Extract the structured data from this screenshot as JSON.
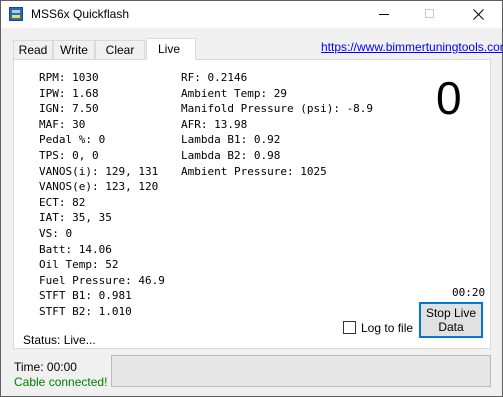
{
  "window": {
    "title": "MSS6x Quickflash",
    "accent_color": "#0078d7",
    "status_ok_color": "#008000",
    "link_color": "#0000ff"
  },
  "tabs": [
    {
      "label": "Read"
    },
    {
      "label": "Write"
    },
    {
      "label": "Clear"
    },
    {
      "label": "Live",
      "selected": true
    }
  ],
  "link": {
    "text": "https://www.bimmertuningtools.com"
  },
  "live": {
    "left_column": [
      "RPM: 1030",
      "IPW: 1.68",
      "IGN: 7.50",
      "MAF: 30",
      "Pedal %: 0",
      "TPS: 0, 0",
      "VANOS(i): 129, 131",
      "VANOS(e): 123, 120",
      "ECT: 82",
      "IAT: 35, 35",
      "VS: 0",
      "Batt: 14.06",
      "Oil Temp: 52",
      "Fuel Pressure: 46.9",
      "STFT B1: 0.981",
      "STFT B2: 1.010"
    ],
    "right_column": [
      "RF: 0.2146",
      "Ambient Temp: 29",
      "Manifold Pressure (psi): -8.9",
      "AFR: 13.98",
      "Lambda B1: 0.92",
      "Lambda B2: 0.98",
      "Ambient Pressure: 1025"
    ],
    "counter": "0",
    "elapsed": "00:20",
    "log_to_file": {
      "label": "Log to file",
      "checked": false
    },
    "stop_button": {
      "line1": "Stop Live",
      "line2": "Data"
    },
    "status": "Status: Live..."
  },
  "footer": {
    "time": "Time: 00:00",
    "cable": "Cable connected!",
    "progress": 0
  }
}
